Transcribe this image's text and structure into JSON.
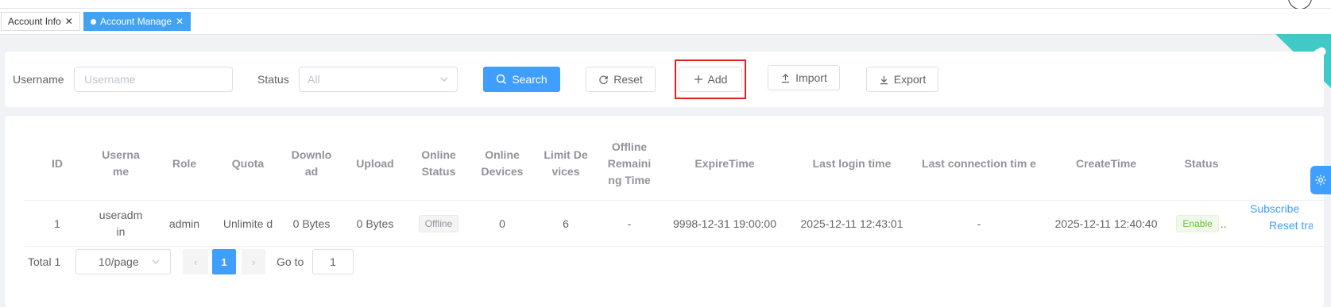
{
  "tabs": [
    {
      "label": "Account Info"
    },
    {
      "label": "Account Manage"
    }
  ],
  "search": {
    "username_label": "Username",
    "username_placeholder": "Username",
    "status_label": "Status",
    "status_value": "All",
    "search_button": "Search",
    "reset_button": "Reset",
    "add_button": "Add",
    "import_button": "Import",
    "export_button": "Export"
  },
  "table": {
    "headers": {
      "id": "ID",
      "username": "Userna me",
      "role": "Role",
      "quota": "Quota",
      "download": "Downlo ad",
      "upload": "Upload",
      "online_status": "Online Status",
      "online_devices": "Online Devices",
      "limit_devices": "Limit De vices",
      "offline_remaining": "Offline Remaini ng Time",
      "expire_time": "ExpireTime",
      "last_login": "Last login time",
      "last_connection": "Last connection tim e",
      "create_time": "CreateTime",
      "status": "Status"
    },
    "rows": [
      {
        "id": "1",
        "username": "useradm in",
        "role": "admin",
        "quota": "Unlimite d",
        "download": "0 Bytes",
        "upload": "0 Bytes",
        "online_status": "Offline",
        "online_devices": "0",
        "limit_devices": "6",
        "offline_remaining": "-",
        "expire_time": "9998-12-31 19:00:00",
        "last_login": "2025-12-11 12:43:01",
        "last_connection": "-",
        "create_time": "2025-12-11 12:40:40",
        "status": "Enable",
        "status_ellipsis": "..",
        "action_subscribe": "Subscribe",
        "action_reset": "Reset tra"
      }
    ]
  },
  "pagination": {
    "total": "Total 1",
    "page_size": "10/page",
    "current_page": "1",
    "goto_label": "Go to",
    "goto_value": "1"
  },
  "colors": {
    "primary": "#409eff",
    "success": "#67c23a",
    "ribbon": "#40c9c6",
    "highlight": "#e02020"
  }
}
